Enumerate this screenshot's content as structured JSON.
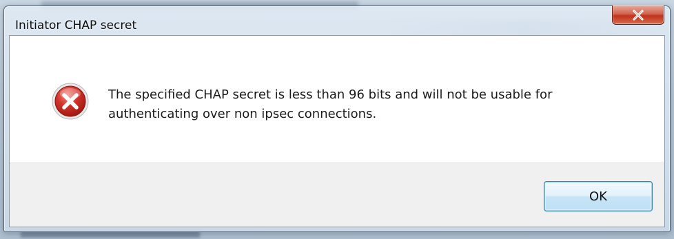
{
  "dialog": {
    "title": "Initiator CHAP secret",
    "message_line1": "The specified CHAP secret is less than 96 bits and will not be usable for",
    "message_line2": "authenticating over non ipsec connections.",
    "ok_label": "OK",
    "close_glyph": "x",
    "icon": "error-icon"
  },
  "colors": {
    "close_button": "#c9402a",
    "error_icon": "#c4221a",
    "ok_border": "#3c7fb1",
    "footer_bg": "#f0f0f0"
  }
}
